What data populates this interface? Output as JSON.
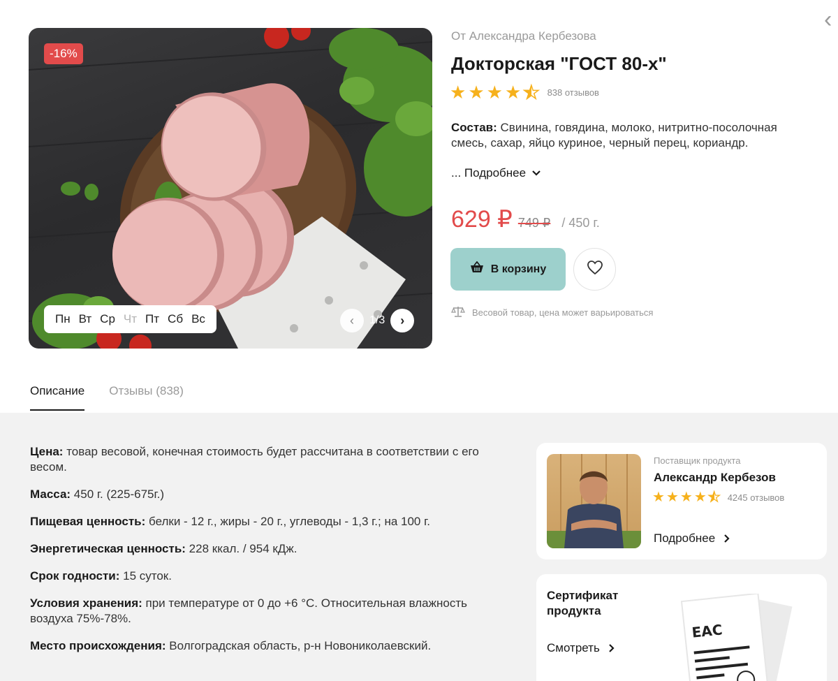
{
  "close_icon": "close-icon",
  "image": {
    "discount": "-16%",
    "days": [
      {
        "label": "Пн",
        "available": true
      },
      {
        "label": "Вт",
        "available": true
      },
      {
        "label": "Ср",
        "available": true
      },
      {
        "label": "Чт",
        "available": false
      },
      {
        "label": "Пт",
        "available": true
      },
      {
        "label": "Сб",
        "available": true
      },
      {
        "label": "Вс",
        "available": true
      }
    ],
    "counter": "1/3"
  },
  "product": {
    "from": "От Александра Кербезова",
    "title": "Докторская \"ГОСТ 80-х\"",
    "rating": 4.5,
    "reviews": "838 отзывов",
    "composition_label": "Состав:",
    "composition_text": " Свинина, говядина, молоко, нитритно-посолочная смесь, сахар, яйцо куриное, черный перец, кориандр.",
    "more": "... Подробнее",
    "price_new": "629 ₽",
    "price_old": "749 ₽",
    "price_unit": "/ 450 г.",
    "cart_label": "В корзину",
    "weight_note": "Весовой товар, цена может варьироваться"
  },
  "tabs": [
    {
      "label": "Описание",
      "active": true
    },
    {
      "label": "Отзывы (838)",
      "active": false
    }
  ],
  "description": [
    {
      "label": "Цена:",
      "text": " товар весовой, конечная стоимость будет рассчитана в соответствии с его весом."
    },
    {
      "label": "Масса:",
      "text": " 450 г. (225-675г.)"
    },
    {
      "label": "Пищевая ценность:",
      "text": " белки - 12 г., жиры - 20 г., углеводы - 1,3 г.; на 100 г."
    },
    {
      "label": "Энергетическая ценность:",
      "text": " 228 ккал. / 954 кДж."
    },
    {
      "label": "Срок годности:",
      "text": " 15 суток."
    },
    {
      "label": "Условия хранения:",
      "text": " при температуре от 0 до +6 °С. Относительная влажность воздуха 75%-78%."
    },
    {
      "label": "Место происхождения:",
      "text": " Волгоградская область, р-н Новониколаевский."
    }
  ],
  "supplier": {
    "label": "Поставщик продукта",
    "name": "Александр Кербезов",
    "rating": 4.5,
    "reviews": "4245 отзывов",
    "more": "Подробнее"
  },
  "certificate": {
    "title": "Сертификат продукта",
    "view": "Смотреть",
    "doc_mark": "EAC"
  },
  "colors": {
    "accent_red": "#e24b4b",
    "cart_button": "#9dd0cc",
    "star": "#f6b11c"
  }
}
